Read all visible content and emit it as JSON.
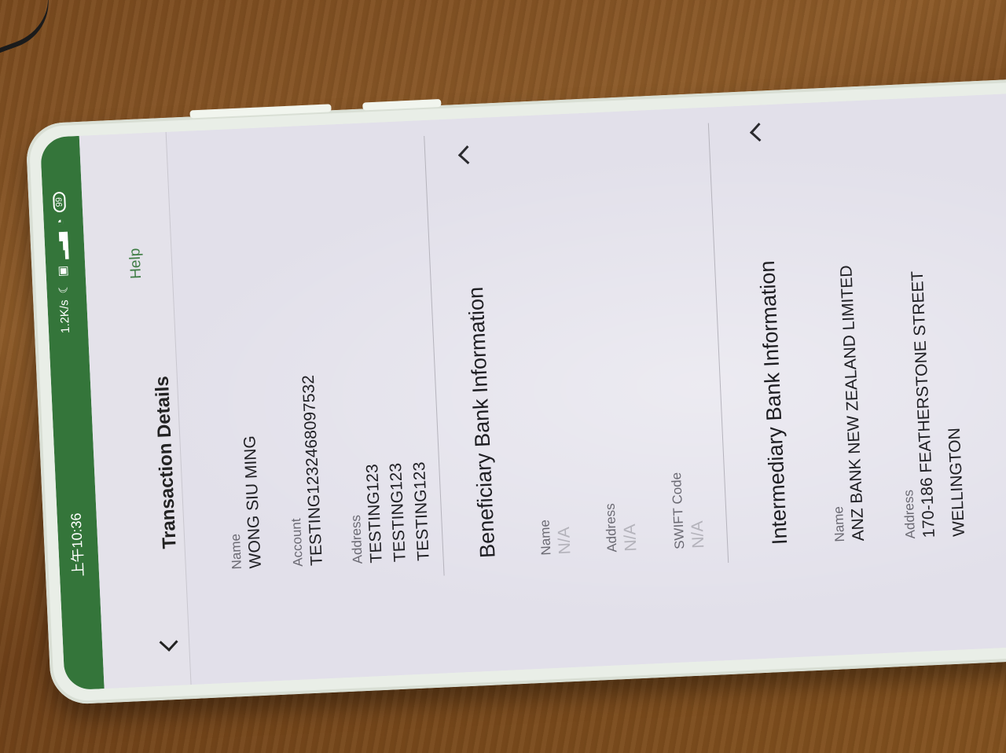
{
  "status_bar": {
    "time": "上午10:36",
    "speed": "1.2K/s",
    "battery": "99"
  },
  "header": {
    "title": "Transaction Details",
    "help": "Help"
  },
  "beneficiary": {
    "name_label": "Name",
    "name": "WONG SIU MING",
    "account_label": "Account",
    "account": "TESTING12324680975​32",
    "address_label": "Address",
    "address_lines": [
      "TESTING123",
      "TESTING123",
      "TESTING123"
    ]
  },
  "beneficiary_bank": {
    "title": "Beneficiary Bank Information",
    "name_label": "Name",
    "name": "N/A",
    "address_label": "Address",
    "address": "N/A",
    "swift_label": "SWIFT Code",
    "swift": "N/A"
  },
  "intermediary_bank": {
    "title": "Intermediary Bank Information",
    "name_label": "Name",
    "name": "ANZ BANK NEW ZEALAND LIMITED",
    "address_label": "Address",
    "address_lines": [
      "170-186 FEATHERSTONE STREET",
      "WELLINGTON"
    ]
  }
}
